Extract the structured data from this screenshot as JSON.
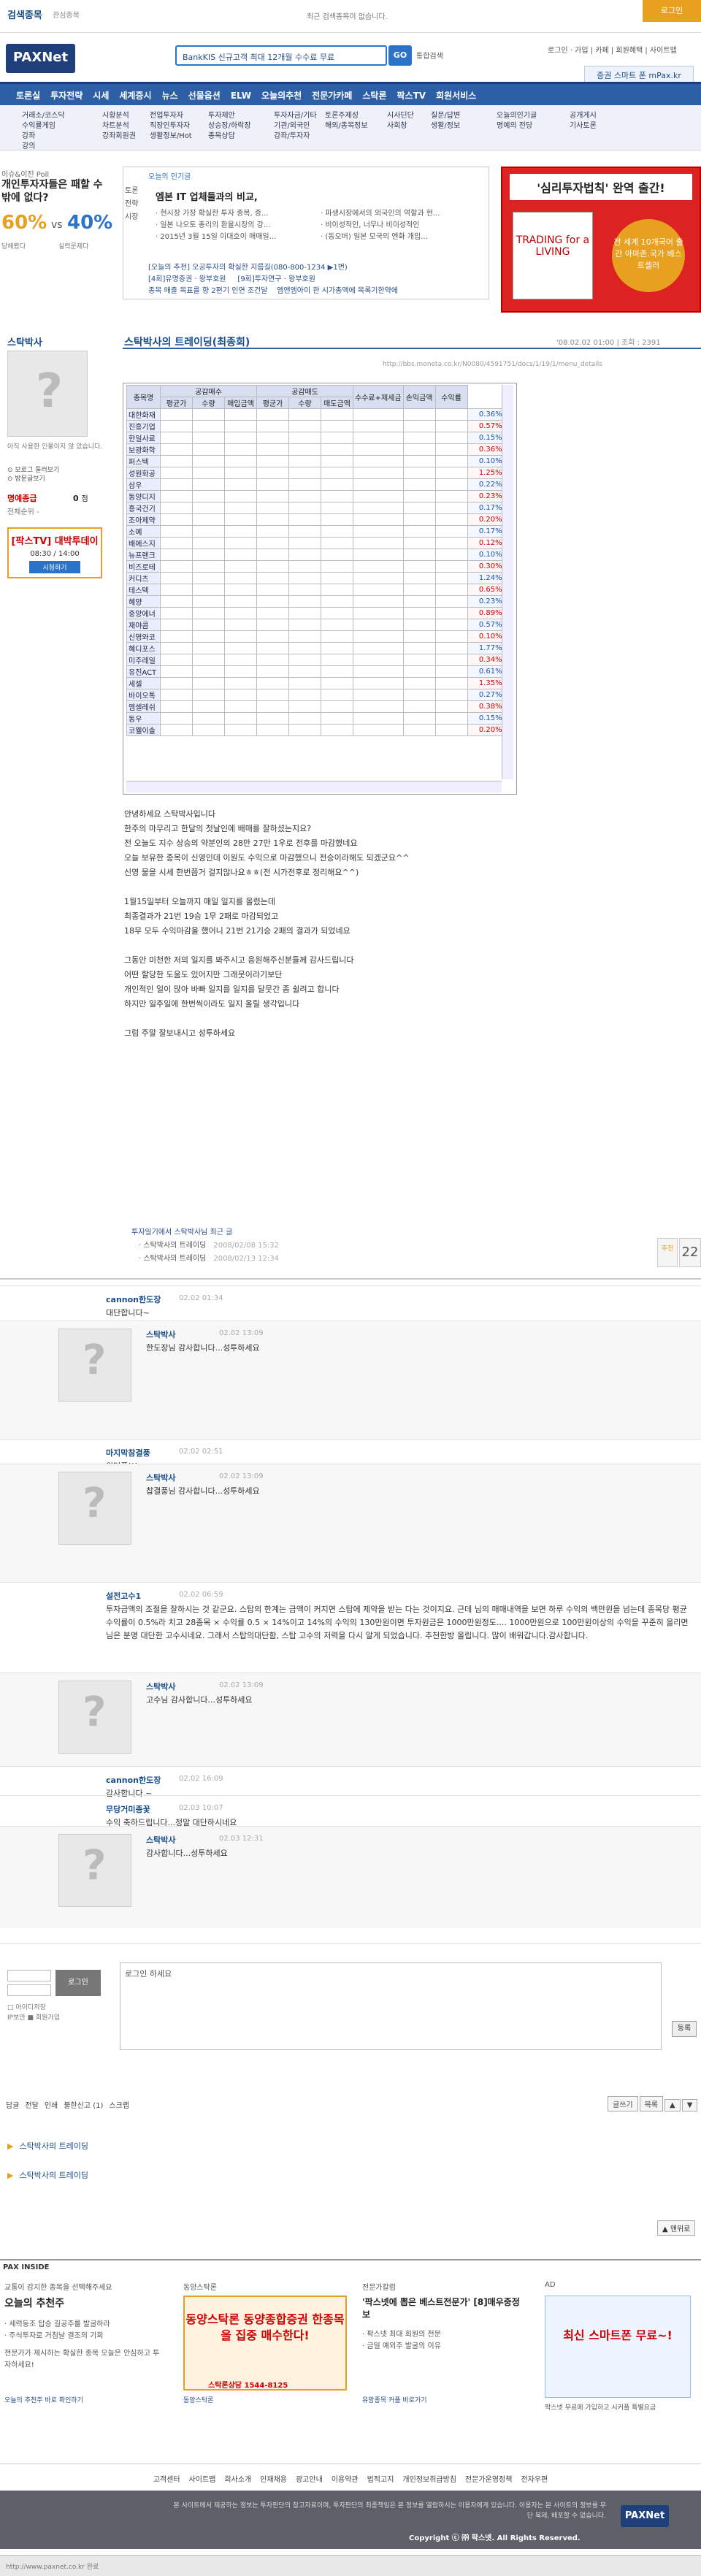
{
  "topbar": {
    "title": "검색종목",
    "subtitle": "관심종목",
    "recent": "최근 검색종목이 없습니다.",
    "login": "로그인"
  },
  "header": {
    "logo": "PAXNet",
    "search_text": "BankKIS 신규고객 최대 12개월 수수료 무료",
    "search_btn": "GO",
    "integrated": "통합검색",
    "toplinks": "로그인 · 가입 | 카페 | 회원혜택 | 사이트맵",
    "mpax": "증권 스마트 폰 mPax.kr"
  },
  "gnb": {
    "items": [
      "토론실",
      "투자전략",
      "시세",
      "세계증시",
      "뉴스",
      "선물옵션",
      "ELW",
      "오늘의추천",
      "전문가카페",
      "스탁론",
      "팍스TV",
      "회원서비스"
    ]
  },
  "subnav": {
    "cols": [
      [
        "거래소/코스닥",
        "수익률게임",
        "강좌",
        "강의"
      ],
      [
        "시황분석",
        "차트분석",
        "강좌회원권"
      ],
      [
        "전업투자자",
        "직장인투자자",
        "생활정보/Hot"
      ],
      [
        "투자제안",
        "상승장/하락장",
        "종목상담"
      ],
      [
        "투자자금/기타",
        "기관/외국인",
        "강좌/투자자"
      ],
      [
        "토론주제성",
        "해외/종목정보"
      ],
      [
        "시사딘단",
        "사회창"
      ],
      [
        "질문/답변",
        "생활/정보"
      ],
      [
        "오늘의인기글",
        "명예의 전당"
      ],
      [
        "공개게시",
        "기사토론"
      ]
    ]
  },
  "side": {
    "label": "이슈&이진 Poll",
    "question": "개인투자자들은 패할 수 밖에 없다?",
    "pct_a": "60%",
    "vs": "vs",
    "pct_b": "40%",
    "label_a": "당해봤다",
    "label_b": "실력문제다"
  },
  "recommend": {
    "header": "오늘의 인기글",
    "tabs": [
      "토론",
      "전략",
      "시장"
    ],
    "title": "엠본 IT 업체들과의 비교,",
    "lines_left": [
      "· 현시장 가장 확실한 투자 종목, 증...",
      "· 일본 나오토 총리의 환율시장의 강...",
      "· 2015년 3월 15일 이대호이 매매일..."
    ],
    "lines_right": [
      "· 파생시장에서의 외국인의 역할과 현...",
      "· 비이성적인, 너무나 비이성적인",
      "· (동오버) 일본 모국의 엔화 개입..."
    ],
    "bottom1": "[오늘의 추천] 오공투자의 확실한 지름길(080-800-1234 ▶1번)",
    "bottom2": "[4회]유명증권 · 왕부호원",
    "bottom3": "[9회]투자연구 · 왕부호원",
    "bottom4": "종목 매출 목표를 향 2편기 인연 조건달",
    "bottom5": "엠앤엠아이 한 시가총액에 목록기한약에"
  },
  "book": {
    "title": "'심리투자법칙' 완역 출간!",
    "cover": "TRADING for a LIVING",
    "badge": "전 세계 10개국어 출간 아마존.국가 베스트셀러"
  },
  "profile": {
    "name": "스탁박사",
    "desc": "아직 사용한 인물이지 않 았습니다.",
    "link1": "⊙ 보로그 둘러보기",
    "link2": "⊙ 방문글보기",
    "fl_label": "명예종급",
    "fl_value": "0",
    "fl_unit": "점",
    "rank": "전체순위 -",
    "tv_a": "[팍스TV] 대박투데이",
    "tv_b": "08:30 / 14:00",
    "tv_c": "시청하기"
  },
  "post": {
    "title": "스탁박사의 트레이딩(최종회)",
    "date": "'08.02.02 01:00 | 조회 : 2391",
    "url": "http://bbs.moneta.co.kr/N0080/4591751/docs/1/19/1/menu_details"
  },
  "sheet": {
    "headers_top": [
      "종목명",
      "공감매수",
      "",
      "",
      "",
      "공감매도",
      "",
      "",
      "",
      "수수료+제세금",
      "손익금액",
      "수익률"
    ],
    "headers_sub": [
      "",
      "평균가",
      "수량",
      "매입금액",
      "평균가",
      "수량",
      "매도금액",
      "",
      "",
      ""
    ],
    "rows": [
      [
        "대한화재",
        "0.36%"
      ],
      [
        "진흥기업",
        "0.57%"
      ],
      [
        "한일사료",
        "0.15%"
      ],
      [
        "보광화학",
        "0.36%"
      ],
      [
        "퍼스텍",
        "0.10%"
      ],
      [
        "성원화공",
        "1.25%"
      ],
      [
        "삼우",
        "0.22%"
      ],
      [
        "동양디지",
        "0.23%"
      ],
      [
        "흥국건기",
        "0.17%"
      ],
      [
        "조아제약",
        "0.20%"
      ],
      [
        "소예",
        "0.17%"
      ],
      [
        "배에스지",
        "0.12%"
      ],
      [
        "뉴프렌크",
        "0.10%"
      ],
      [
        "비즈로테",
        "0.30%"
      ],
      [
        "커디츠",
        "1.24%"
      ],
      [
        "테스텍",
        "0.65%"
      ],
      [
        "혜양",
        "0.23%"
      ],
      [
        "중앙에너",
        "0.89%"
      ],
      [
        "재야콤",
        "0.57%"
      ],
      [
        "신영와코",
        "0.10%"
      ],
      [
        "혜디포스",
        "1.77%"
      ],
      [
        "미주레일",
        "0.34%"
      ],
      [
        "유진ACT",
        "0.61%"
      ],
      [
        "세셀",
        "1.35%"
      ],
      [
        "바이오톡",
        "0.27%"
      ],
      [
        "엠셀레쉬",
        "0.38%"
      ],
      [
        "동우",
        "0.15%"
      ],
      [
        "코웰이솔",
        "0.20%"
      ]
    ]
  },
  "body": [
    "안녕하세요 스탁박사입니다",
    "한주의 마무리고 한달의 첫날인에 배매를 잘하셨는지요?",
    "전 오늘도 지수 상승의 약분인의 28만 27만 1우로 전후를 마감했네요",
    "오늘 보유한 종목이 신영인데 이원도 수익으로 마감했으니 전승이라해도 되겠군요^^",
    "신영 물을 시세 한번쯤거 걸지않나요ㅎㅎ(전 시가전후로 정리해요^^)",
    "",
    "1월15일부터 오늘까지 매일 일지를 올렸는데",
    "최종결과가 21번 19승 1무 2패로 마감되었고",
    "18무 모두 수익마감을 했어니 21번 21기승 2패의 결과가 되었네요",
    "",
    "그동안 미천한 저의 일지를 봐주시고 응원해주신분들께 감사드립니다",
    "어떤 할당한 도움도 있어지만 그래뭇이라기보단",
    "개인적인 일이 많아 바빠 일지를 일지를 달뭇간 좀 쉴려고 합니다",
    "하지만 일주일에 한번씩이라도 일지 올릴 생각입니다",
    "",
    "그럼 주말 잘보내시고 성투하세요"
  ],
  "vote": {
    "label": "추천",
    "count": "22"
  },
  "related": {
    "title": "투자일기에서 스탁박사님 최근 글",
    "items": [
      {
        "t": "· 스탁박사의 트레이딩",
        "d": "2008/02/08 15:32"
      },
      {
        "t": "· 스탁박사의 트레이딩",
        "d": "2008/02/13 12:34"
      }
    ]
  },
  "comments": [
    {
      "author": "cannon한도장",
      "date": "02.02 01:34",
      "text": "대단합니다~"
    },
    {
      "author": "스탁박사",
      "date": "02.02 13:09",
      "text": "한도장님 감사합니다...성투하세요",
      "reply": true
    },
    {
      "author": "마지막참결풍",
      "date": "02.02 02:51",
      "text": "원더풀!!!"
    },
    {
      "author": "스탁박사",
      "date": "02.02 13:09",
      "text": "찹결풍님 감사합니다...성투하세요",
      "reply": true
    },
    {
      "author": "설전고수1",
      "date": "02.02 06:59",
      "text": "투자금액의 조절을 잘하시는 것 같군요. 스탑의 한계는 금액이 커지면 스탑에 제약을 받는 다는 것이지요. 근데 님의 매매내역을 보면 하루 수익의 백만원을 넘는데 종목당 평균수익률이 0.5%라 치고 28종목 × 수익률 0.5 × 14%이고 14%의 수익의 130만원이면 투자원금은 1000만원정도.... 1000만원으로 100만원이상의 수익을 꾸준히 올리면 님은 분명 대단한 고수시네요. 그래서 스탑의대단함, 스탑 고수의 저력을 다시 알게 되었습니다. 추천한방 올립니다. 많이 배워갑니다.감사합니다."
    },
    {
      "author": "스탁박사",
      "date": "02.02 13:09",
      "text": "고수님 감사합니다...성투하세요",
      "reply": true
    },
    {
      "author": "cannon한도장",
      "date": "02.02 16:09",
      "text": "감사합니다.~"
    },
    {
      "author": "무당거미종꽃",
      "date": "02.03 10:07",
      "text": "수익 축하드립니다...정말 대단하시네요"
    },
    {
      "author": "스탁박사",
      "date": "02.03 12:31",
      "text": "감사합니다...성투하세요",
      "reply": true
    }
  ],
  "form": {
    "login_btn": "로그인",
    "save_id": "□ 아이디저장",
    "ssl": "IP보안 ■ 회원가입",
    "textarea": "로그인 하세요",
    "register": "등록"
  },
  "actions": {
    "left": [
      "답글",
      "전달",
      "인쇄",
      "불한신고 (1)",
      "스크랩"
    ],
    "right": [
      "글쓰기",
      "목록",
      "▲",
      "▼"
    ]
  },
  "nav": {
    "prev": "스탁박사의 트레이딩",
    "next": "스탁박사의 트레이딩"
  },
  "top_btn": "▲ 맨위로",
  "inside": {
    "title": "PAX INSIDE",
    "box1_h": "교통이 감지한 종목을 선택해주세요",
    "box1_t": "오늘의 추천주",
    "box1_items": [
      "· 세력동조 탑승 길공주를 발굴하라",
      "· 주식투자로 거침날 결조의 기회",
      "전문가가 제시하는 확실한 종목 오늘은 안심하고 투자하세요!"
    ],
    "box1_link": "오늘의 추천주 바로 확인하기",
    "box2_h": "동양스탁론",
    "box2_ad": "동양스탁론 동양종합증권 한종목을 집중 매수한다!",
    "box2_phone": "스탁론상담 1544-8125",
    "box2_link": "동양스탁론",
    "box3_h": "전문가칼럼",
    "box3_t": "'팍스넷에 뽑은 베스트전문가' [8]매우중정보",
    "box3_items": [
      "· 팍스넷 최대 회원의 전문",
      "· 금일 예외주 발굴의 이유"
    ],
    "box3_link": "유망종목 커플 바로가기",
    "box4_h": "AD",
    "box4_t": "최신 스마트폰 무료~!",
    "box4_small": "팍스넷 무료에 가입하고 시커플 특별요금"
  },
  "footer_links": [
    "고객센터",
    "사이트맵",
    "회사소개",
    "인재채용",
    "광고안내",
    "이용약관",
    "법적고지",
    "개인정보취급방침",
    "전문가운영정책",
    "전자우편"
  ],
  "footer": {
    "text": "본 사이트에서 제공하는 정보는 투자판단의 참고자료이며, 투자판단의 최종책임은 본 정보를 열람하시는 이용자에게 있습니다. 이용자는 본 사이트의 정보를 무단 복제, 배포할 수 없습니다.",
    "logo": "PAXNet",
    "copy": "Copyright ⓒ ㈜ 팍스넷. All Rights Reserved."
  },
  "status": "http://www.paxnet.co.kr 완료"
}
